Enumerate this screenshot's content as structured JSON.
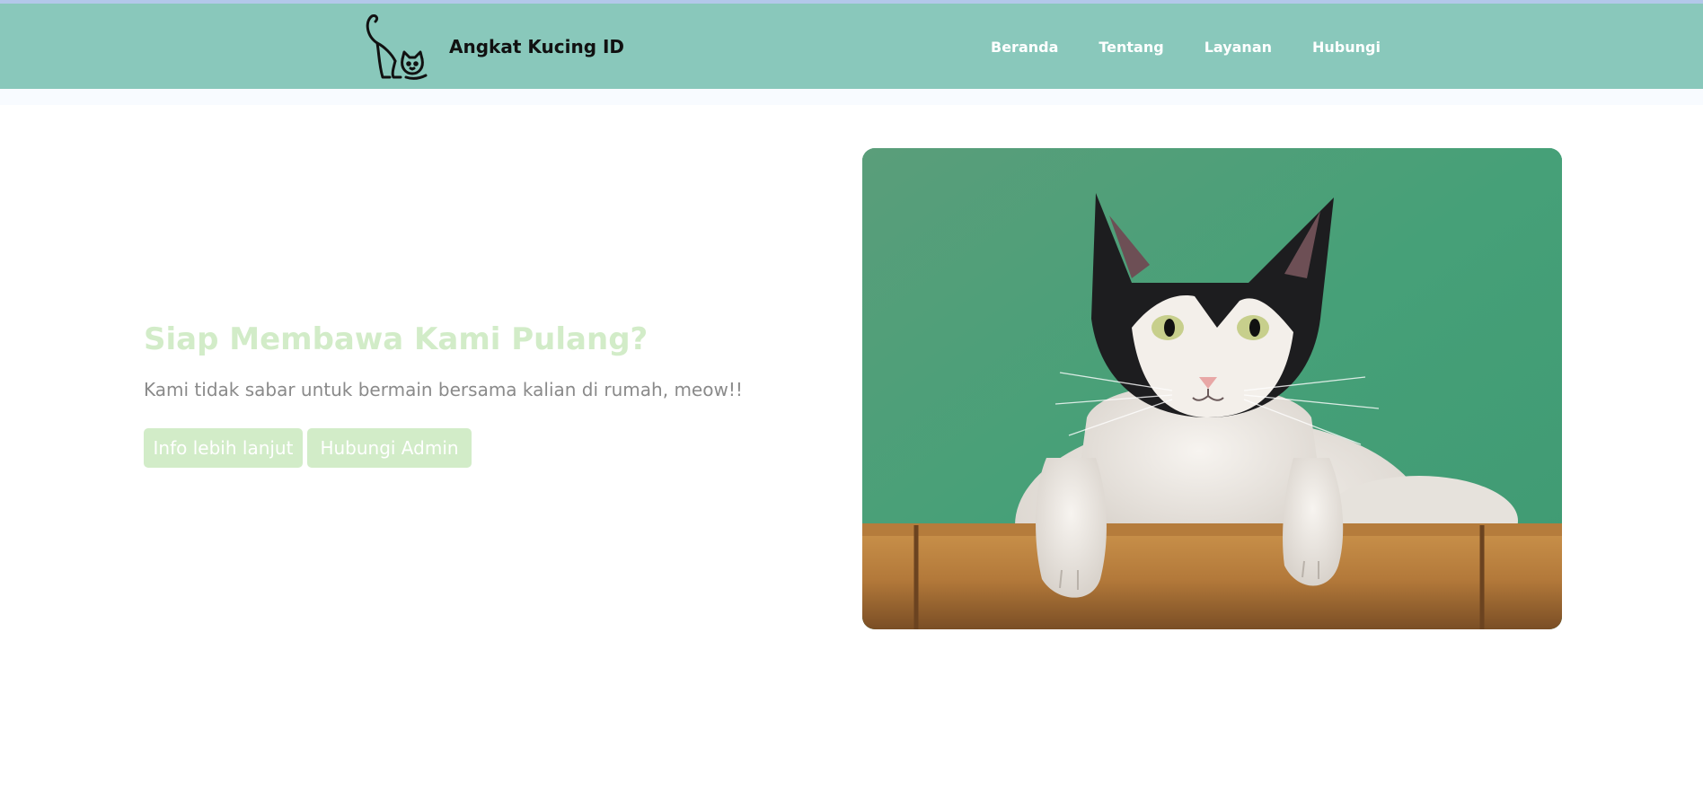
{
  "brand": {
    "name": "Angkat Kucing ID",
    "logo_icon": "cat-logo-icon"
  },
  "nav": {
    "items": [
      {
        "label": "Beranda"
      },
      {
        "label": "Tentang"
      },
      {
        "label": "Layanan"
      },
      {
        "label": "Hubungi"
      }
    ]
  },
  "hero": {
    "title": "Siap Membawa Kami Pulang?",
    "subtitle": "Kami tidak sabar untuk bermain bersama kalian di rumah, meow!!",
    "buttons": {
      "info_label": "Info lebih lanjut",
      "admin_label": "Hubungi Admin"
    },
    "image_icon": "cat-photo"
  },
  "colors": {
    "navbar": "#89c8bb",
    "accent": "#d2ecc8",
    "topline": "#b3c8ea"
  }
}
